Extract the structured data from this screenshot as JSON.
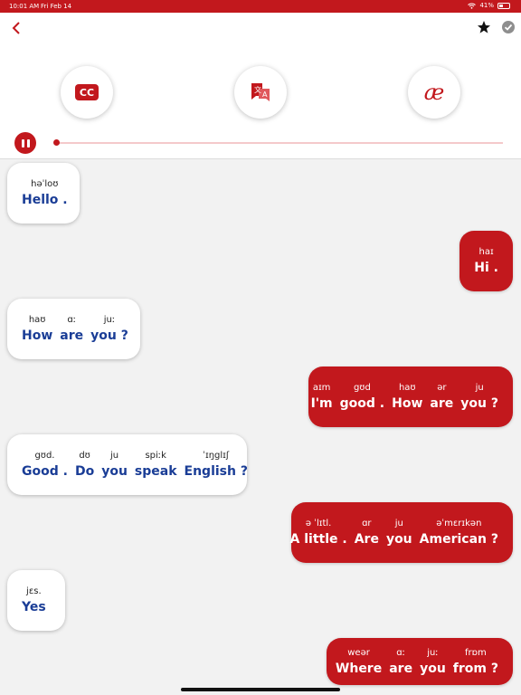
{
  "status": {
    "time": "10:01 AM",
    "date": "Fri Feb 14",
    "battery": "41%"
  },
  "toolbar": {
    "cc_label": "CC",
    "ae_label": "æ"
  },
  "messages": [
    {
      "side": "them",
      "words": [
        {
          "ipa": "həˈloʊ",
          "text": "Hello ."
        }
      ]
    },
    {
      "side": "me",
      "words": [
        {
          "ipa": "haɪ",
          "text": "Hi ."
        }
      ]
    },
    {
      "side": "them",
      "words": [
        {
          "ipa": "haʊ",
          "text": "How"
        },
        {
          "ipa": "ɑː",
          "text": "are"
        },
        {
          "ipa": "juː",
          "text": "you ?"
        }
      ]
    },
    {
      "side": "me",
      "words": [
        {
          "ipa": "aɪm",
          "text": "I'm"
        },
        {
          "ipa": "gʊd",
          "text": "good ."
        },
        {
          "ipa": "haʊ",
          "text": "How"
        },
        {
          "ipa": "ər",
          "text": "are"
        },
        {
          "ipa": "ju",
          "text": "you ?"
        }
      ]
    },
    {
      "side": "them",
      "words": [
        {
          "ipa": "gʊd.",
          "text": "Good ."
        },
        {
          "ipa": "dʊ",
          "text": "Do"
        },
        {
          "ipa": "ju",
          "text": "you"
        },
        {
          "ipa": "spiːk",
          "text": "speak"
        },
        {
          "ipa": "ˈɪŋglɪʃ",
          "text": "English ?"
        }
      ]
    },
    {
      "side": "me",
      "words": [
        {
          "ipa": "ə ˈlɪtl.",
          "text": "A little ."
        },
        {
          "ipa": "ɑr",
          "text": "Are"
        },
        {
          "ipa": "ju",
          "text": "you"
        },
        {
          "ipa": "əˈmɛrɪkən",
          "text": "American ?"
        }
      ]
    },
    {
      "side": "them",
      "words": [
        {
          "ipa": "jɛs.",
          "text": "Yes"
        }
      ]
    },
    {
      "side": "me",
      "words": [
        {
          "ipa": "weər",
          "text": "Where"
        },
        {
          "ipa": "ɑː",
          "text": "are"
        },
        {
          "ipa": "juː",
          "text": "you"
        },
        {
          "ipa": "frɒm",
          "text": "from ?"
        }
      ]
    }
  ]
}
